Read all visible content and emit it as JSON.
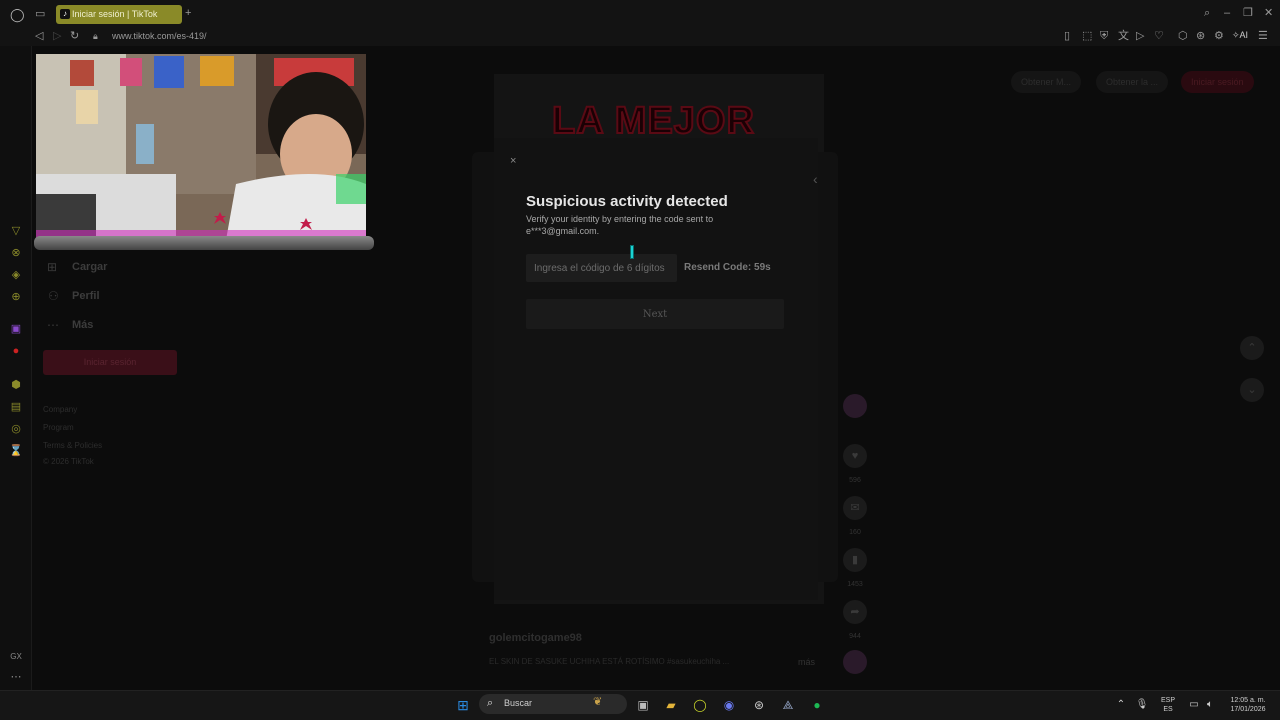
{
  "browser": {
    "tab_title": "Iniciar sesión | TikTok",
    "url": "www.tiktok.com/es-419/",
    "new_tab": "+"
  },
  "tiktok": {
    "nav": [
      {
        "label": "Cargar",
        "icon": "upload-icon"
      },
      {
        "label": "Perfil",
        "icon": "profile-icon"
      },
      {
        "label": "Más",
        "icon": "more-icon"
      }
    ],
    "login_button": "Iniciar sesión",
    "footer_links": [
      "Company",
      "Program",
      "Terms & Policies",
      "© 2026 TikTok"
    ],
    "header_buttons": [
      "Obtener M...",
      "Obtener la ...",
      "Iniciar sesión"
    ],
    "video_banner": "LA MEJOR",
    "video_user": "golemcitogame98",
    "video_desc": "EL SKIN DE SASUKE UCHIHA ESTÁ ROTÍSIMO #sasukeuchiha ...",
    "video_more": "más",
    "rail_counts": [
      "596",
      "160",
      "1453",
      "944"
    ]
  },
  "modal": {
    "title": "Suspicious activity detected",
    "description": "Verify your identity by entering the code sent to e***3@gmail.com.",
    "code_placeholder": "Ingresa el código de 6 dígitos",
    "resend": "Resend Code: 59s",
    "next": "Next",
    "close": "×"
  },
  "taskbar": {
    "search_label": "Buscar",
    "language": "ESP",
    "language_sub": "ES",
    "time": "12:05 a. m.",
    "date": "17/01/2026"
  },
  "colors": {
    "accent_tab": "#8a8a28",
    "tiktok_red": "#3a0f18",
    "cursor": "#1ad4d4"
  }
}
